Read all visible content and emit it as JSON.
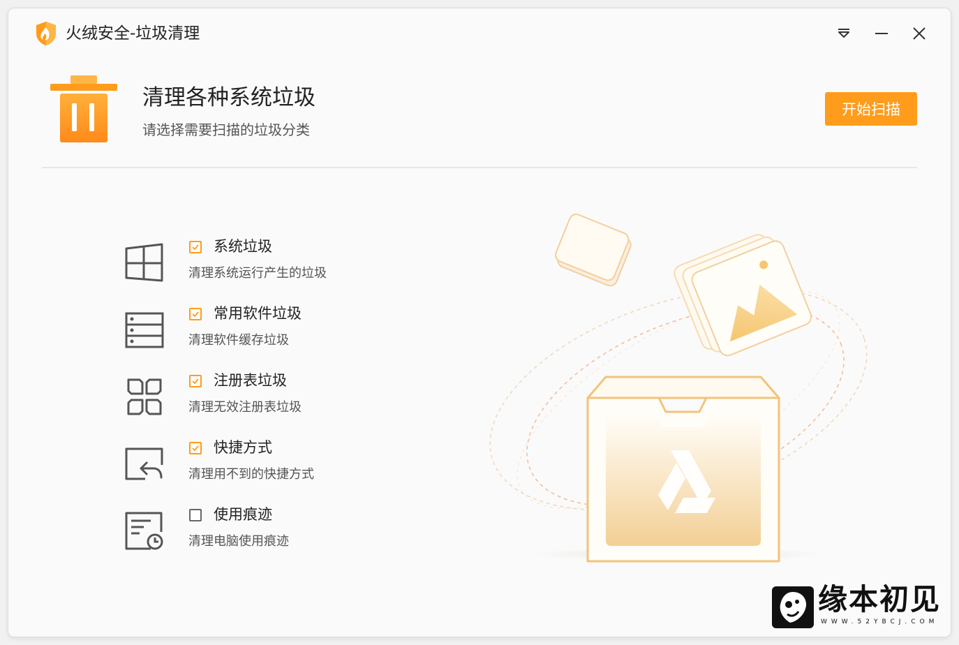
{
  "window": {
    "title": "火绒安全-垃圾清理",
    "controls": [
      "menu-icon",
      "minimize-icon",
      "close-icon"
    ]
  },
  "header": {
    "title": "清理各种系统垃圾",
    "subtitle": "请选择需要扫描的垃圾分类",
    "scan_button": "开始扫描",
    "icon": "trash-icon"
  },
  "categories": [
    {
      "label": "系统垃圾",
      "desc": "清理系统运行产生的垃圾",
      "checked": true,
      "icon": "windows-icon"
    },
    {
      "label": "常用软件垃圾",
      "desc": "清理软件缓存垃圾",
      "checked": true,
      "icon": "server-list-icon"
    },
    {
      "label": "注册表垃圾",
      "desc": "清理无效注册表垃圾",
      "checked": true,
      "icon": "registry-grid-icon"
    },
    {
      "label": "快捷方式",
      "desc": "清理用不到的快捷方式",
      "checked": true,
      "icon": "shortcut-icon"
    },
    {
      "label": "使用痕迹",
      "desc": "清理电脑使用痕迹",
      "checked": false,
      "icon": "history-doc-icon"
    }
  ],
  "colors": {
    "accent": "#ff9c1b",
    "text_primary": "#222222",
    "text_secondary": "#555555"
  },
  "watermark": {
    "text": "缘本初见",
    "url": "WWW.52YBCJ.COM"
  }
}
